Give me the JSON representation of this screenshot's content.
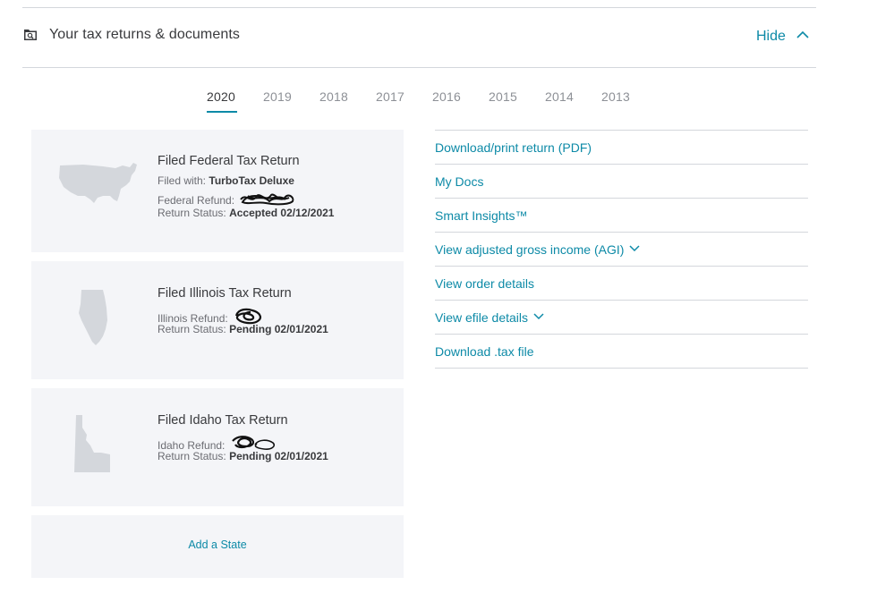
{
  "header": {
    "title": "Your tax returns & documents",
    "hide_label": "Hide",
    "folder_icon": "folder-search-icon",
    "toggle_icon": "chevron-up-icon"
  },
  "year_tabs": {
    "active": "2020",
    "items": [
      "2020",
      "2019",
      "2018",
      "2017",
      "2016",
      "2015",
      "2014",
      "2013"
    ]
  },
  "returns": {
    "federal": {
      "title": "Filed Federal Tax Return",
      "filed_with_label": "Filed with:",
      "filed_with_value": "TurboTax Deluxe",
      "refund_label": "Federal Refund:",
      "status_label": "Return Status:",
      "status_value": "Accepted 02/12/2021",
      "map_icon": "usa-map-icon"
    },
    "illinois": {
      "title": "Filed Illinois Tax Return",
      "refund_label": "Illinois Refund:",
      "status_label": "Return Status:",
      "status_value": "Pending 02/01/2021",
      "map_icon": "illinois-map-icon"
    },
    "idaho": {
      "title": "Filed Idaho Tax Return",
      "refund_label": "Idaho Refund:",
      "status_label": "Return Status:",
      "status_value": "Pending 02/01/2021",
      "map_icon": "idaho-map-icon"
    },
    "add_state_label": "Add a State"
  },
  "actions": [
    {
      "label": "Download/print return (PDF)",
      "expandable": false
    },
    {
      "label": "My Docs",
      "expandable": false
    },
    {
      "label": "Smart Insights™",
      "expandable": false
    },
    {
      "label": "View adjusted gross income (AGI)",
      "expandable": true
    },
    {
      "label": "View order details",
      "expandable": false
    },
    {
      "label": "View efile details",
      "expandable": true
    },
    {
      "label": "Download .tax file",
      "expandable": false
    }
  ],
  "colors": {
    "accent": "#0d8aa7",
    "card_bg": "#f4f5f8",
    "divider": "#d4d7dc",
    "text": "#393a3d",
    "muted": "#8d9096",
    "map": "#d4d7dc"
  }
}
